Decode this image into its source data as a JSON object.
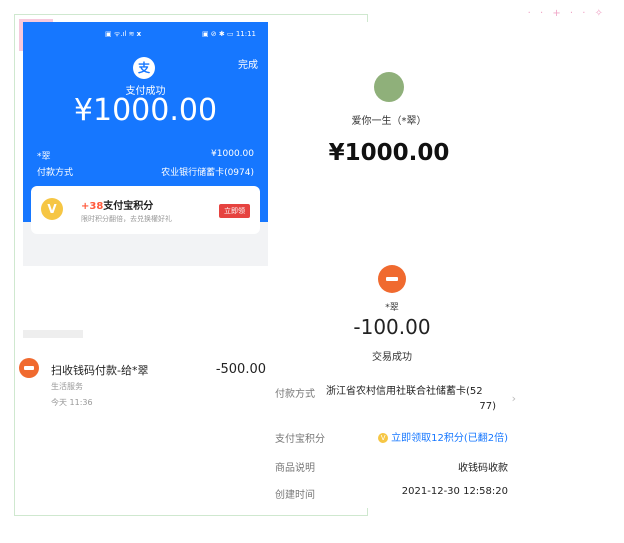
{
  "payment_screen": {
    "status_left": "▣ ᯤ.ıl ≋ 𝘅",
    "status_right": "▣ ⊘ ✱ ▭ 11:11",
    "done_label": "完成",
    "logo_glyph": "支",
    "success_text": "支付成功",
    "amount": "¥1000.00",
    "payee": "*翠",
    "payee_amount": "¥1000.00",
    "method_label": "付款方式",
    "method_value": "农业银行储蓄卡(0974)",
    "points": {
      "badge": "V",
      "plus": "+38",
      "title": "支付宝积分",
      "subtitle": "限时积分翻倍，去兑换權好礼",
      "button": "立即领"
    }
  },
  "receipt_screen": {
    "name": "爱你一生（*翠）",
    "amount": "¥1000.00"
  },
  "bill_list": {
    "title": "扫收钱码付款-给*翠",
    "amount": "-500.00",
    "category": "生活服务",
    "time": "今天  11:36"
  },
  "detail_screen": {
    "name": "*翠",
    "amount": "-100.00",
    "status": "交易成功",
    "rows": {
      "method_label": "付款方式",
      "method_value_1": "浙江省农村信用社联合社储蓄卡(52",
      "method_value_2": "77)",
      "points_label": "支付宝积分",
      "points_value": "立即领取12积分(已翻2倍)",
      "note_label": "商品说明",
      "note_value": "收钱码收款",
      "created_label": "创建时间",
      "created_value": "2021-12-30 12:58:20"
    }
  },
  "colors": {
    "alipay_blue": "#1677ff",
    "accent_red": "#e64340",
    "bill_orange": "#f06a2f",
    "points_gold": "#f6c644"
  }
}
